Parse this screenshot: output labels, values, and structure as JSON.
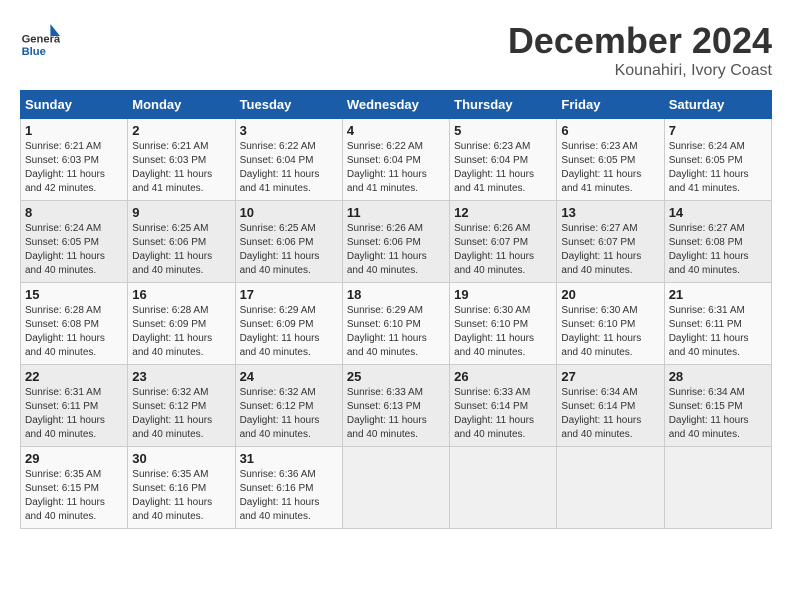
{
  "header": {
    "logo_general": "General",
    "logo_blue": "Blue",
    "title": "December 2024",
    "subtitle": "Kounahiri, Ivory Coast"
  },
  "calendar": {
    "month": "December 2024",
    "location": "Kounahiri, Ivory Coast",
    "weekdays": [
      "Sunday",
      "Monday",
      "Tuesday",
      "Wednesday",
      "Thursday",
      "Friday",
      "Saturday"
    ],
    "weeks": [
      [
        {
          "day": "1",
          "sunrise": "6:21 AM",
          "sunset": "6:03 PM",
          "daylight": "11 hours and 42 minutes."
        },
        {
          "day": "2",
          "sunrise": "6:21 AM",
          "sunset": "6:03 PM",
          "daylight": "11 hours and 41 minutes."
        },
        {
          "day": "3",
          "sunrise": "6:22 AM",
          "sunset": "6:04 PM",
          "daylight": "11 hours and 41 minutes."
        },
        {
          "day": "4",
          "sunrise": "6:22 AM",
          "sunset": "6:04 PM",
          "daylight": "11 hours and 41 minutes."
        },
        {
          "day": "5",
          "sunrise": "6:23 AM",
          "sunset": "6:04 PM",
          "daylight": "11 hours and 41 minutes."
        },
        {
          "day": "6",
          "sunrise": "6:23 AM",
          "sunset": "6:05 PM",
          "daylight": "11 hours and 41 minutes."
        },
        {
          "day": "7",
          "sunrise": "6:24 AM",
          "sunset": "6:05 PM",
          "daylight": "11 hours and 41 minutes."
        }
      ],
      [
        {
          "day": "8",
          "sunrise": "6:24 AM",
          "sunset": "6:05 PM",
          "daylight": "11 hours and 40 minutes."
        },
        {
          "day": "9",
          "sunrise": "6:25 AM",
          "sunset": "6:06 PM",
          "daylight": "11 hours and 40 minutes."
        },
        {
          "day": "10",
          "sunrise": "6:25 AM",
          "sunset": "6:06 PM",
          "daylight": "11 hours and 40 minutes."
        },
        {
          "day": "11",
          "sunrise": "6:26 AM",
          "sunset": "6:06 PM",
          "daylight": "11 hours and 40 minutes."
        },
        {
          "day": "12",
          "sunrise": "6:26 AM",
          "sunset": "6:07 PM",
          "daylight": "11 hours and 40 minutes."
        },
        {
          "day": "13",
          "sunrise": "6:27 AM",
          "sunset": "6:07 PM",
          "daylight": "11 hours and 40 minutes."
        },
        {
          "day": "14",
          "sunrise": "6:27 AM",
          "sunset": "6:08 PM",
          "daylight": "11 hours and 40 minutes."
        }
      ],
      [
        {
          "day": "15",
          "sunrise": "6:28 AM",
          "sunset": "6:08 PM",
          "daylight": "11 hours and 40 minutes."
        },
        {
          "day": "16",
          "sunrise": "6:28 AM",
          "sunset": "6:09 PM",
          "daylight": "11 hours and 40 minutes."
        },
        {
          "day": "17",
          "sunrise": "6:29 AM",
          "sunset": "6:09 PM",
          "daylight": "11 hours and 40 minutes."
        },
        {
          "day": "18",
          "sunrise": "6:29 AM",
          "sunset": "6:10 PM",
          "daylight": "11 hours and 40 minutes."
        },
        {
          "day": "19",
          "sunrise": "6:30 AM",
          "sunset": "6:10 PM",
          "daylight": "11 hours and 40 minutes."
        },
        {
          "day": "20",
          "sunrise": "6:30 AM",
          "sunset": "6:10 PM",
          "daylight": "11 hours and 40 minutes."
        },
        {
          "day": "21",
          "sunrise": "6:31 AM",
          "sunset": "6:11 PM",
          "daylight": "11 hours and 40 minutes."
        }
      ],
      [
        {
          "day": "22",
          "sunrise": "6:31 AM",
          "sunset": "6:11 PM",
          "daylight": "11 hours and 40 minutes."
        },
        {
          "day": "23",
          "sunrise": "6:32 AM",
          "sunset": "6:12 PM",
          "daylight": "11 hours and 40 minutes."
        },
        {
          "day": "24",
          "sunrise": "6:32 AM",
          "sunset": "6:12 PM",
          "daylight": "11 hours and 40 minutes."
        },
        {
          "day": "25",
          "sunrise": "6:33 AM",
          "sunset": "6:13 PM",
          "daylight": "11 hours and 40 minutes."
        },
        {
          "day": "26",
          "sunrise": "6:33 AM",
          "sunset": "6:14 PM",
          "daylight": "11 hours and 40 minutes."
        },
        {
          "day": "27",
          "sunrise": "6:34 AM",
          "sunset": "6:14 PM",
          "daylight": "11 hours and 40 minutes."
        },
        {
          "day": "28",
          "sunrise": "6:34 AM",
          "sunset": "6:15 PM",
          "daylight": "11 hours and 40 minutes."
        }
      ],
      [
        {
          "day": "29",
          "sunrise": "6:35 AM",
          "sunset": "6:15 PM",
          "daylight": "11 hours and 40 minutes."
        },
        {
          "day": "30",
          "sunrise": "6:35 AM",
          "sunset": "6:16 PM",
          "daylight": "11 hours and 40 minutes."
        },
        {
          "day": "31",
          "sunrise": "6:36 AM",
          "sunset": "6:16 PM",
          "daylight": "11 hours and 40 minutes."
        },
        null,
        null,
        null,
        null
      ]
    ]
  }
}
